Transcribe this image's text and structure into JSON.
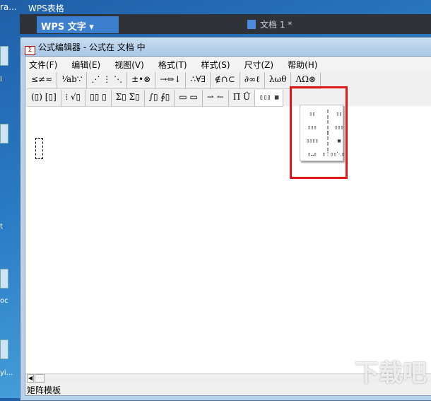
{
  "taskbar": {
    "left_text": "ra...",
    "app": "WPS表格"
  },
  "wps": {
    "button": "WPS 文字",
    "doc_title": "文档 1 *"
  },
  "desktop_labels": [
    "l",
    "t",
    "oc",
    "yi..."
  ],
  "window": {
    "title": "公式编辑器 - 公式在 文档  中"
  },
  "menu": [
    "文件(F)",
    "编辑(E)",
    "视图(V)",
    "格式(T)",
    "样式(S)",
    "尺寸(Z)",
    "帮助(H)"
  ],
  "toolbar_row1": [
    "≤≠≈",
    "⅟ab∵",
    "⋰ ⋮ ⋱",
    "±•⊗",
    "→⇔↓",
    "∴∀∃",
    "∉∩⊂",
    "∂∞ℓ",
    "λωθ",
    "ΛΩ⊛"
  ],
  "toolbar_row2": [
    "(▯) [▯]",
    "⁞ √▯",
    "▯▯ ▯",
    "Σ▯ Σ▯",
    "∫▯ ∮▯",
    "▭ ▭",
    "⇀ ↼",
    "Π̈ Ü",
    "▯▯▯ ▦"
  ],
  "matrix_palette": [
    "▯▯",
    "▯▯",
    "▯▯",
    "▯▯▯",
    "▯▯▯",
    "▯▯▯",
    "▯▯▯▯",
    "▯▯▯▯",
    "▦",
    "▯…▯",
    "▯⋮▯",
    "▯⋱▯"
  ],
  "status": "矩阵模板",
  "watermark": "下载吧",
  "colors": {
    "highlight": "#e01818",
    "wps_blue": "#3d7fcf"
  }
}
